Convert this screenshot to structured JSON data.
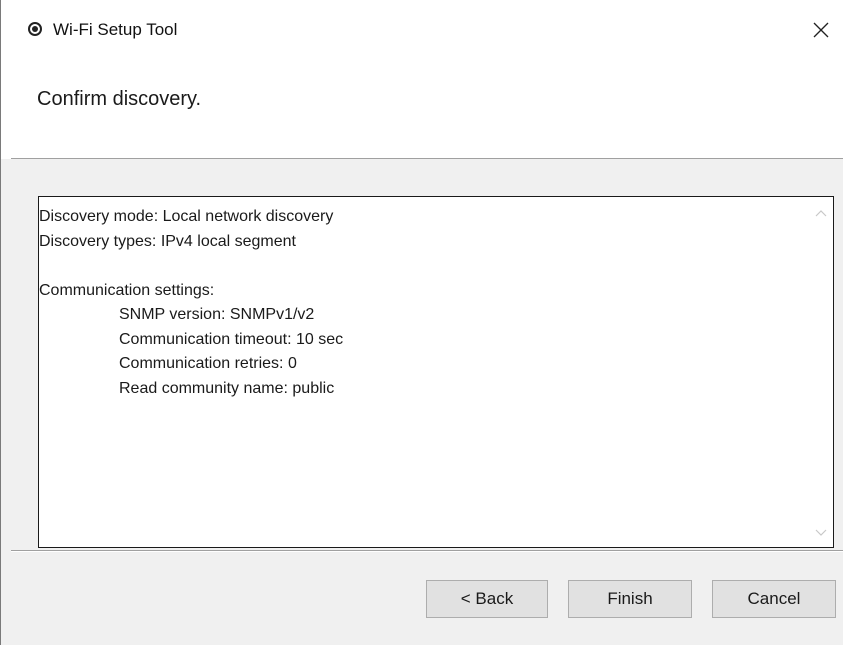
{
  "window": {
    "title": "Wi-Fi Setup Tool",
    "close_label": "×"
  },
  "header": {
    "prompt": "Confirm discovery."
  },
  "summary": {
    "lines": [
      {
        "text": "Discovery mode: Local network discovery",
        "indent": false
      },
      {
        "text": "Discovery types: IPv4 local segment",
        "indent": false
      },
      {
        "text": "",
        "indent": false
      },
      {
        "text": "Communication settings:",
        "indent": false
      },
      {
        "text": "SNMP version: SNMPv1/v2",
        "indent": true
      },
      {
        "text": "Communication timeout: 10 sec",
        "indent": true
      },
      {
        "text": "Communication retries: 0",
        "indent": true
      },
      {
        "text": "Read community name: public",
        "indent": true
      }
    ]
  },
  "buttons": {
    "back": "< Back",
    "finish": "Finish",
    "cancel": "Cancel"
  },
  "icons": {
    "app": "app-radio-icon",
    "close": "close-icon",
    "scroll_up": "chevron-up-icon",
    "scroll_down": "chevron-down-icon"
  }
}
